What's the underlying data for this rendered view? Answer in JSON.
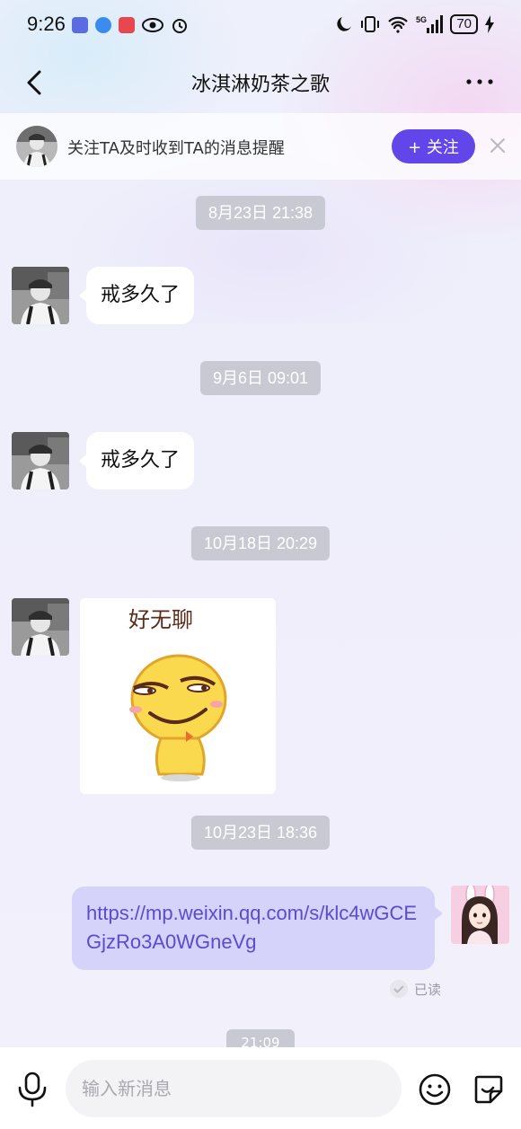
{
  "status_bar": {
    "time": "9:26",
    "battery": "70",
    "network": "5G"
  },
  "header": {
    "title": "冰淇淋奶茶之歌"
  },
  "follow_banner": {
    "text": "关注TA及时收到TA的消息提醒",
    "follow_label": "+ 关注"
  },
  "messages": [
    {
      "time": "8月23日 21:38",
      "text": "戒多久了"
    },
    {
      "time": "9月6日 09:01",
      "text": "戒多久了"
    },
    {
      "time": "10月18日 20:29",
      "sticker_caption": "好无聊"
    },
    {
      "time": "10月23日 18:36",
      "link": "https://mp.weixin.qq.com/s/klc4wGCEGjzRo3A0WGneVg",
      "read": "已读"
    }
  ],
  "partial_time": "21:09",
  "input": {
    "placeholder": "输入新消息"
  },
  "colors": {
    "accent": "#6246ea",
    "right_bubble": "#d5d3f9",
    "link_text": "#5a4bd0",
    "time_chip": "#c9c9d4"
  }
}
